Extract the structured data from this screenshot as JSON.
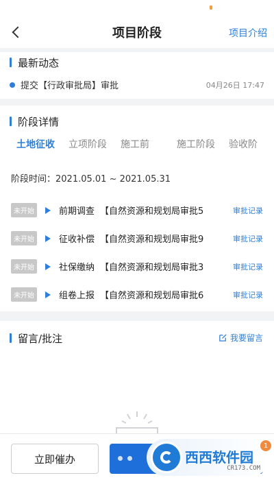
{
  "nav": {
    "title": "项目阶段",
    "right_link": "项目介绍"
  },
  "latest": {
    "section_title": "最新动态",
    "item_text": "提交【行政审批局】审批",
    "item_time": "04月26日 17:47"
  },
  "stage": {
    "section_title": "阶段详情",
    "tabs": [
      {
        "label": "土地征收",
        "active": true
      },
      {
        "label": "立项阶段",
        "active": false
      },
      {
        "label": "施工前",
        "active": false
      },
      {
        "label": "施工阶段",
        "active": false
      },
      {
        "label": "验收阶",
        "active": false
      }
    ],
    "period": "阶段时间：2021.05.01 ~ 2021.05.31",
    "steps": [
      {
        "status": "未开始",
        "name": "前期调查",
        "org": "【自然资源和规划局审批5",
        "link": "审批记录"
      },
      {
        "status": "未开始",
        "name": "征收补偿",
        "org": "【自然资源和规划局审批9",
        "link": "审批记录"
      },
      {
        "status": "未开始",
        "name": "社保缴纳",
        "org": "【自然资源和规划局审批3",
        "link": "审批记录"
      },
      {
        "status": "未开始",
        "name": "组卷上报",
        "org": "【自然资源和规划局审批6",
        "link": "审批记录"
      }
    ]
  },
  "comments": {
    "section_title": "留言/批注",
    "action_label": "我要留言"
  },
  "bottom": {
    "urge_label": "立即催办"
  },
  "watermark": {
    "title": "西西软件园",
    "subtitle": "CR173.COM",
    "badge_count": "1"
  },
  "colors": {
    "accent": "#2f7fd8",
    "badge_bg": "#c8c8c8",
    "primary_button": "#1e6fd9"
  }
}
